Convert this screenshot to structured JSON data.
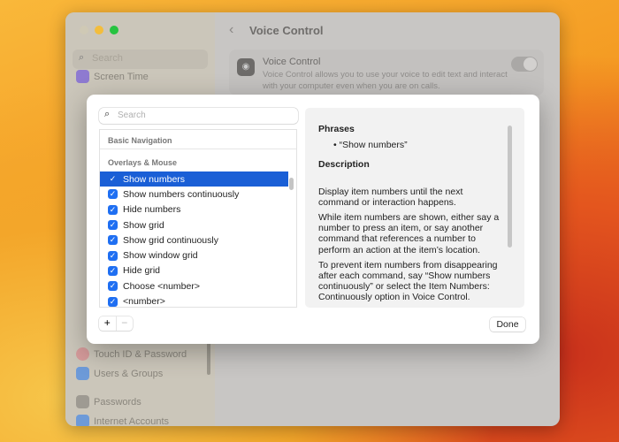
{
  "sidebar": {
    "search_placeholder": "Search",
    "items": [
      "Screen Time",
      "Touch ID & Password",
      "Users & Groups",
      "Passwords",
      "Internet Accounts"
    ]
  },
  "main": {
    "title": "Voice Control",
    "card": {
      "title": "Voice Control",
      "description": "Voice Control allows you to use your voice to edit text and interact with your computer even when you are on calls.",
      "enabled": true
    }
  },
  "dialog": {
    "search_placeholder": "Search",
    "sections": [
      "Basic Navigation",
      "Overlays & Mouse"
    ],
    "commands": [
      {
        "label": "Show numbers",
        "checked": true,
        "selected": true
      },
      {
        "label": "Show numbers continuously",
        "checked": true
      },
      {
        "label": "Hide numbers",
        "checked": true
      },
      {
        "label": "Show grid",
        "checked": true
      },
      {
        "label": "Show grid continuously",
        "checked": true
      },
      {
        "label": "Show window grid",
        "checked": true
      },
      {
        "label": "Hide grid",
        "checked": true
      },
      {
        "label": "Choose <number>",
        "checked": true
      },
      {
        "label": "<number>",
        "checked": true
      }
    ],
    "add_label": "+",
    "remove_label": "−",
    "detail": {
      "phrases_heading": "Phrases",
      "phrase": "• “Show numbers”",
      "description_heading": "Description",
      "paragraphs": [
        "Display item numbers until the next command or interaction happens.",
        "While item numbers are shown, either say a number to press an item, or say another command that references a number to perform an action at the item’s location.",
        "To prevent item numbers from disappearing after each command, say “Show numbers continuously” or select the Item Numbers: Continuously option in Voice Control."
      ]
    },
    "done_label": "Done"
  }
}
